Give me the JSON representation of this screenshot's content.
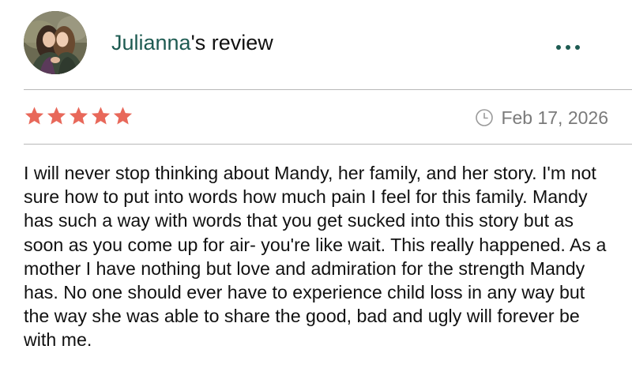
{
  "review": {
    "reviewer_name": "Julianna",
    "title_suffix": "'s review",
    "avatar": "two-people-photo",
    "rating": 5,
    "rating_max": 5,
    "date": "Feb 17, 2026",
    "date_icon": "clock-icon",
    "more_icon": "more-dots-icon",
    "body": "I will never stop thinking about Mandy, her family, and her story. I'm not sure how to put into words how much pain I feel for this family. Mandy has such a way with words that you get sucked into this story but as soon as you come up for air- you're like wait. This really happened. As a mother I have nothing but love and admiration for the strength Mandy has. No one should ever have to experience child loss in any way but the way she was able to share the good, bad and ugly will forever be with me."
  },
  "colors": {
    "name_accent": "#1e5b52",
    "star": "#e8685a",
    "muted_text": "#7a7a7a",
    "divider": "#b8b8b8"
  }
}
